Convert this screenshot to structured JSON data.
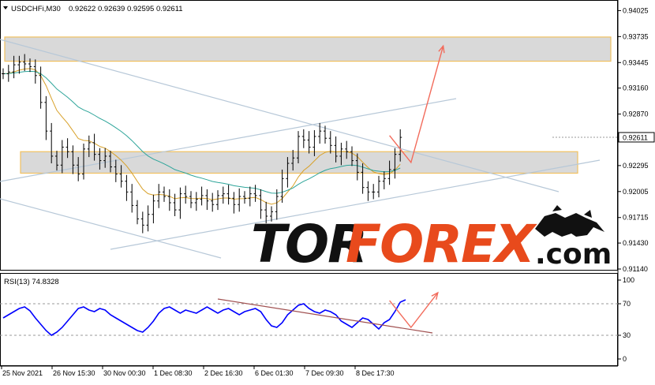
{
  "header": {
    "symbol_label": "USDCHFi,M30",
    "ohlc": "0.92622 0.92639 0.92595 0.92611"
  },
  "rsi_header": "RSI(13) 74.8328",
  "watermark": {
    "part1": "TOR",
    "part2": "FOREX",
    "part3": ".com"
  },
  "colors": {
    "price": "#000000",
    "ma_fast": "#d8a12a",
    "ma_slow": "#2ea59a",
    "channel": "#b7c8d8",
    "zone_fill": "#d9d9d9",
    "zone_border": "#f0c060",
    "forecast_arrow": "#f26b5b",
    "rsi_line": "#0000ff",
    "rsi_trend": "#a05050",
    "watermark_dark": "#111111",
    "watermark_accent": "#e84a1c"
  },
  "icons": {
    "dropdown": "triangle-down-icon",
    "logo": "bull-logo-icon"
  },
  "chart_data": [
    {
      "type": "line",
      "title": "USDCHFi,M30",
      "ylim": [
        0.9114,
        0.9402
      ],
      "y_ticks": [
        "0.94025",
        "0.93735",
        "0.93445",
        "0.93160",
        "0.92870",
        "0.92295",
        "0.92005",
        "0.91715",
        "0.91430",
        "0.91140"
      ],
      "current_price_label": "0.92611",
      "x_ticks": [
        "25 Nov 2021",
        "26 Nov 15:30",
        "30 Nov 00:30",
        "1 Dec 08:30",
        "2 Dec 16:30",
        "6 Dec 01:30",
        "7 Dec 09:30",
        "8 Dec 17:30"
      ],
      "series": [
        {
          "values": [
            0.9332,
            0.9334,
            0.9342,
            0.9345,
            0.9343,
            0.934,
            0.933,
            0.93,
            0.9268,
            0.924,
            0.923,
            0.925,
            0.9245,
            0.923,
            0.922,
            0.9248,
            0.9255,
            0.9242,
            0.9235,
            0.924,
            0.9228,
            0.922,
            0.9212,
            0.92,
            0.9185,
            0.917,
            0.9163,
            0.9175,
            0.919,
            0.92,
            0.9195,
            0.9188,
            0.918,
            0.9198,
            0.9195,
            0.9188,
            0.9192,
            0.9196,
            0.919,
            0.9186,
            0.9196,
            0.9198,
            0.9193,
            0.9186,
            0.9195,
            0.9193,
            0.9198,
            0.9196,
            0.918,
            0.9173,
            0.9178,
            0.9195,
            0.9215,
            0.9232,
            0.9238,
            0.9262,
            0.9258,
            0.925,
            0.9262,
            0.9268,
            0.926,
            0.9252,
            0.924,
            0.9248,
            0.9245,
            0.9235,
            0.9222,
            0.9205,
            0.92,
            0.92,
            0.9212,
            0.9215,
            0.9225,
            0.9242,
            0.9261
          ]
        }
      ],
      "zones": [
        {
          "low": 0.9346,
          "high": 0.9373
        },
        {
          "low": 0.9221,
          "high": 0.9245
        }
      ],
      "forecast_path": [
        {
          "x": 72,
          "y": 0.9263
        },
        {
          "x": 76,
          "y": 0.9233
        },
        {
          "x": 82,
          "y": 0.9363
        }
      ]
    },
    {
      "type": "line",
      "title": "RSI(13)",
      "ylim": [
        0,
        100
      ],
      "y_ticks": [
        "100",
        "70",
        "30",
        "0"
      ],
      "last_value": "74.8328",
      "levels": [
        70,
        30
      ],
      "series": [
        {
          "values": [
            52,
            56,
            60,
            64,
            66,
            61,
            52,
            44,
            36,
            30,
            34,
            40,
            48,
            56,
            64,
            66,
            62,
            60,
            64,
            62,
            56,
            52,
            48,
            44,
            40,
            36,
            34,
            40,
            48,
            58,
            64,
            66,
            62,
            58,
            62,
            60,
            58,
            62,
            66,
            62,
            58,
            62,
            64,
            60,
            56,
            60,
            62,
            64,
            60,
            50,
            42,
            40,
            46,
            56,
            62,
            68,
            70,
            64,
            60,
            58,
            62,
            60,
            56,
            48,
            44,
            40,
            46,
            52,
            50,
            44,
            38,
            46,
            50,
            60,
            72,
            75
          ]
        }
      ],
      "trendline": [
        {
          "x": 40,
          "v": 76
        },
        {
          "x": 80,
          "v": 33
        }
      ],
      "forecast_path": [
        {
          "x": 72,
          "v": 74
        },
        {
          "x": 76,
          "v": 40
        },
        {
          "x": 81,
          "v": 84
        }
      ]
    }
  ]
}
